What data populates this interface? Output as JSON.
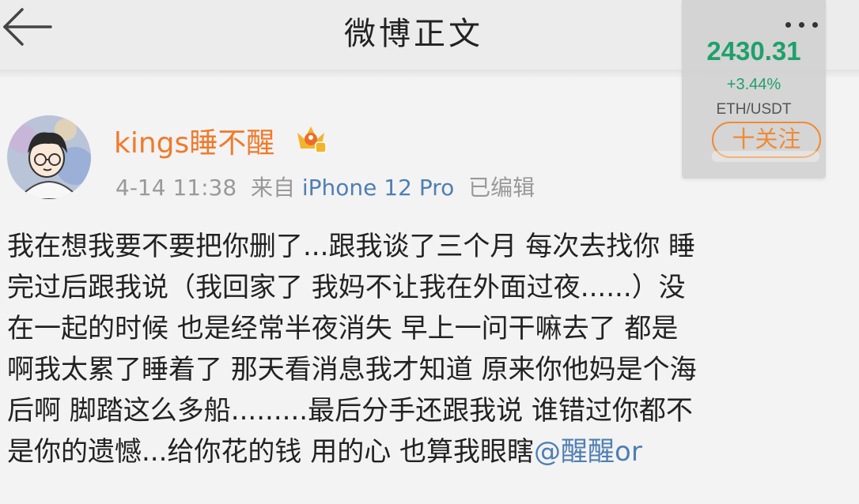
{
  "header": {
    "title": "微博正文",
    "back_icon": "arrow-left-icon",
    "more_icon": "more-dots-icon"
  },
  "ticker": {
    "price": "2430.31",
    "change": "+3.44%",
    "pair": "ETH/USDT",
    "follow_label": "十关注",
    "accent_color": "#1fa06b"
  },
  "post": {
    "author": "kings睡不醒",
    "badge_icon": "crown-member-badge-icon",
    "meta": {
      "date": "4-14 11:38",
      "source_prefix": "来自",
      "source_device": "iPhone 12 Pro",
      "edited": "已编辑"
    },
    "lines": [
      "我在想我要不要把你删了...跟我谈了三个月 每次去找你 睡",
      "完过后跟我说（我回家了 我妈不让我在外面过夜......）没",
      "在一起的时候 也是经常半夜消失 早上一问干嘛去了 都是",
      "啊我太累了睡着了 那天看消息我才知道 原来你他妈是个海",
      "后啊 脚踏这么多船.........最后分手还跟我说 谁错过你都不"
    ],
    "last_line_text": "是你的遗憾...给你花的钱 用的心 也算我眼瞎",
    "mention": "@醒醒or"
  },
  "colors": {
    "username": "#ef7b2c",
    "link": "#4f7fb2",
    "follow": "#f08a34"
  }
}
